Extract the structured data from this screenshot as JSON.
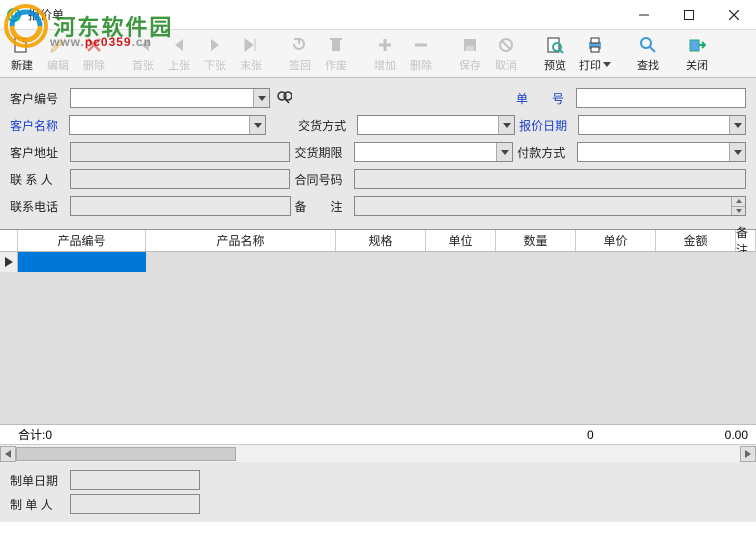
{
  "window": {
    "title": "报价单"
  },
  "watermark": {
    "text": "河东软件园",
    "url_part1": "www.",
    "url_part2": "pc0359",
    "url_part3": ".cn"
  },
  "toolbar": {
    "new": "新建",
    "edit": "编辑",
    "delete": "删除",
    "first": "首张",
    "prev": "上张",
    "next": "下张",
    "last": "末张",
    "signback": "签回",
    "void": "作废",
    "add": "增加",
    "remove": "删除",
    "save": "保存",
    "cancel": "取消",
    "preview": "预览",
    "print": "打印",
    "find": "查找",
    "close": "关闭"
  },
  "form": {
    "labels": {
      "customer_no": "客户编号",
      "customer_name": "客户名称",
      "customer_addr": "客户地址",
      "contact": "联 系 人",
      "phone": "联系电话",
      "order_no": "单　　号",
      "delivery_method": "交货方式",
      "quote_date": "报价日期",
      "delivery_deadline": "交货期限",
      "payment_method": "付款方式",
      "contract_no": "合同号码",
      "remarks": "备　　注"
    },
    "values": {
      "customer_no": "",
      "customer_name": "",
      "customer_addr": "",
      "contact": "",
      "phone": "",
      "order_no": "",
      "delivery_method": "",
      "quote_date": "",
      "delivery_deadline": "",
      "payment_method": "",
      "contract_no": "",
      "remarks": ""
    }
  },
  "grid": {
    "columns": [
      "产品编号",
      "产品名称",
      "规格",
      "单位",
      "数量",
      "单价",
      "金额",
      "备注"
    ],
    "totals": {
      "label": "合计:",
      "count": "0",
      "qty": "0",
      "amount": "0.00"
    }
  },
  "footer": {
    "labels": {
      "make_date": "制单日期",
      "maker": "制 单 人"
    },
    "values": {
      "make_date": "",
      "maker": ""
    }
  }
}
